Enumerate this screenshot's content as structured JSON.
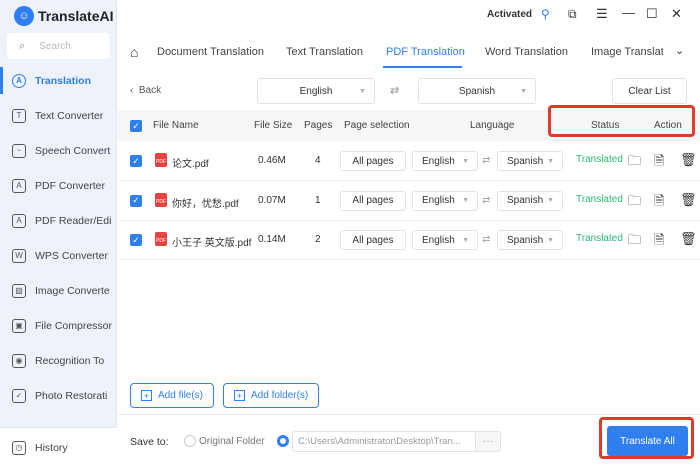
{
  "app": {
    "name": "TranslateAI",
    "status": "Activated"
  },
  "sidebar": {
    "search_placeholder": "Search",
    "items": [
      {
        "label": "Translation",
        "icon": "translate-icon",
        "glyph": "A"
      },
      {
        "label": "Text Converter",
        "icon": "text-converter-icon",
        "glyph": "T"
      },
      {
        "label": "Speech Convert",
        "icon": "speech-icon",
        "glyph": "~"
      },
      {
        "label": "PDF Converter",
        "icon": "pdf-converter-icon",
        "glyph": "A"
      },
      {
        "label": "PDF Reader/Edi",
        "icon": "pdf-reader-icon",
        "glyph": "A"
      },
      {
        "label": "WPS Converter",
        "icon": "wps-icon",
        "glyph": "W"
      },
      {
        "label": "Image Converte",
        "icon": "image-converter-icon",
        "glyph": "▨"
      },
      {
        "label": "File Compressor",
        "icon": "compress-icon",
        "glyph": "▣"
      },
      {
        "label": "Recognition To",
        "icon": "recognition-icon",
        "glyph": "◉"
      },
      {
        "label": "Photo Restorati",
        "icon": "photo-restore-icon",
        "glyph": "✓"
      }
    ],
    "history": "History"
  },
  "tabs": [
    "Document Translation",
    "Text Translation",
    "PDF Translation",
    "Word Translation",
    "Image Translat"
  ],
  "active_tab": "PDF Translation",
  "toolbar": {
    "back": "Back",
    "source_lang": "English",
    "target_lang": "Spanish",
    "clear": "Clear List"
  },
  "table": {
    "headers": [
      "File Name",
      "File Size",
      "Pages",
      "Page selection",
      "Language",
      "Status",
      "Action"
    ],
    "rows": [
      {
        "name": "论文.pdf",
        "size": "0.46M",
        "pages": "4",
        "selection": "All pages",
        "from": "English",
        "to": "Spanish",
        "status": "Translated"
      },
      {
        "name": "你好，忧愁.pdf",
        "size": "0.07M",
        "pages": "1",
        "selection": "All pages",
        "from": "English",
        "to": "Spanish",
        "status": "Translated"
      },
      {
        "name": "小王子 英文版.pdf",
        "size": "0.14M",
        "pages": "2",
        "selection": "All pages",
        "from": "English",
        "to": "Spanish",
        "status": "Translated"
      }
    ]
  },
  "buttons": {
    "add_files": "Add file(s)",
    "add_folders": "Add folder(s)",
    "translate_all": "Translate All"
  },
  "save": {
    "label": "Save to:",
    "original": "Original Folder",
    "path": "C:\\Users\\Administrator\\Desktop\\Tran...",
    "browse": "···"
  },
  "colors": {
    "accent": "#2f7ff0",
    "success": "#2bb673",
    "highlight": "#e03a2a"
  }
}
